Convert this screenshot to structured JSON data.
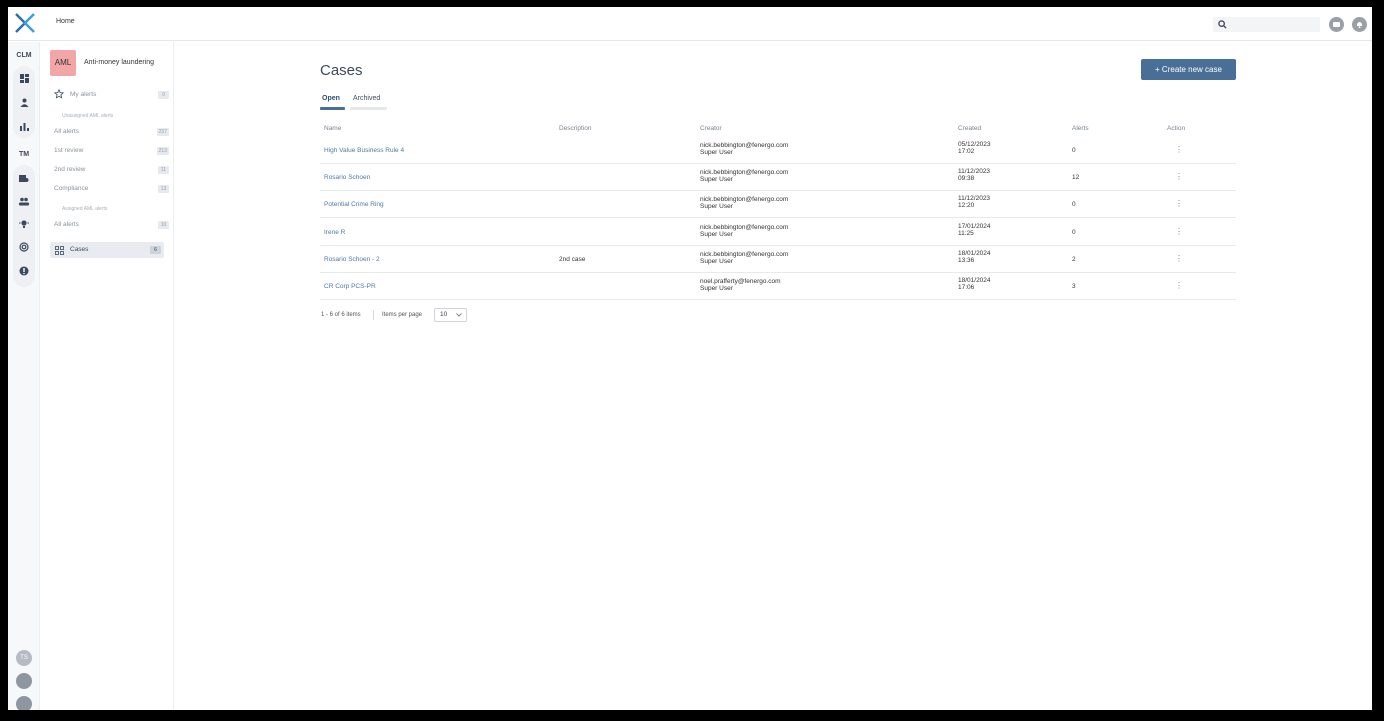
{
  "header": {
    "breadcrumb": "Home",
    "search_placeholder": ""
  },
  "rail": {
    "labels": [
      "CLM",
      "TM"
    ],
    "user_initials": "TS"
  },
  "sidebar": {
    "module_badge": "AML",
    "module_title": "Anti-money laundering",
    "my_alerts": {
      "label": "My alerts",
      "count": "0"
    },
    "unassigned_header": "Unassigned AML alerts",
    "unassigned": [
      {
        "label": "All alerts",
        "count": "237"
      },
      {
        "label": "1st review",
        "count": "213"
      },
      {
        "label": "2nd review",
        "count": "11"
      },
      {
        "label": "Compliance",
        "count": "13"
      }
    ],
    "assigned_header": "Assigned AML alerts",
    "assigned": [
      {
        "label": "All alerts",
        "count": "10"
      }
    ],
    "cases": {
      "label": "Cases",
      "count": "6"
    }
  },
  "main": {
    "title": "Cases",
    "create_button": "+ Create new case",
    "tabs": [
      "Open",
      "Archived"
    ],
    "columns": [
      "Name",
      "Description",
      "Creator",
      "Created",
      "Alerts",
      "Action"
    ],
    "rows": [
      {
        "name": "High Value Business Rule 4",
        "description": "",
        "creator": "nick.bebbington@fenergo.com",
        "role": "Super User",
        "date": "05/12/2023",
        "time": "17:02",
        "alerts": "0",
        "action": "⋮"
      },
      {
        "name": "Rosario Schoen",
        "description": "",
        "creator": "nick.bebbington@fenergo.com",
        "role": "Super User",
        "date": "11/12/2023",
        "time": "09:38",
        "alerts": "12",
        "action": "⋮"
      },
      {
        "name": "Potential Crime Ring",
        "description": "",
        "creator": "nick.bebbington@fenergo.com",
        "role": "Super User",
        "date": "11/12/2023",
        "time": "12:20",
        "alerts": "0",
        "action": "⋮"
      },
      {
        "name": "Irene R",
        "description": "",
        "creator": "nick.bebbington@fenergo.com",
        "role": "Super User",
        "date": "17/01/2024",
        "time": "11:25",
        "alerts": "0",
        "action": "⋮"
      },
      {
        "name": "Rosario Schoen - 2",
        "description": "2nd case",
        "creator": "nick.bebbington@fenergo.com",
        "role": "Super User",
        "date": "18/01/2024",
        "time": "13:36",
        "alerts": "2",
        "action": "⋮"
      },
      {
        "name": "CR Corp PCS-PR",
        "description": "",
        "creator": "noel.prafferty@fenergo.com",
        "role": "Super User",
        "date": "18/01/2024",
        "time": "17:06",
        "alerts": "3",
        "action": "⋮"
      }
    ],
    "pagination": {
      "summary": "1 - 6 of 6 items",
      "per_page_label": "Items per page",
      "per_page_value": "10"
    }
  },
  "colors": {
    "accent": "#4a6f96",
    "link": "#4f79a8",
    "aml_badge": "#f2a6a6"
  }
}
